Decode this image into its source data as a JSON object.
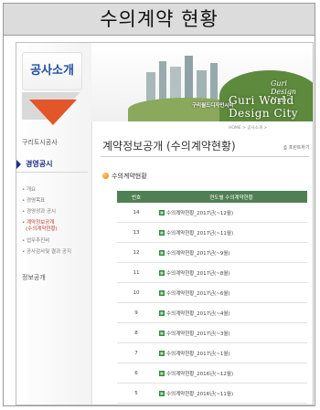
{
  "caption": "수의계약 현황",
  "sidebar": {
    "title": "공사소개",
    "items": [
      {
        "label": "구리도시공사",
        "active": false
      },
      {
        "label": "경영공시",
        "active": true
      }
    ],
    "subitems": [
      {
        "label": "• 개요",
        "highlight": false
      },
      {
        "label": "• 경영목표",
        "highlight": false
      },
      {
        "label": "• 경영성과 공시",
        "highlight": false
      },
      {
        "label": "• 계약정보공개",
        "highlight": true
      },
      {
        "label": "(수의계약현황)",
        "highlight": true
      },
      {
        "label": "• 업무추진비",
        "highlight": false
      },
      {
        "label": "• 공사감사및 결과 공지",
        "highlight": false
      }
    ],
    "bottom": "정보공개"
  },
  "banner": {
    "sub": "구리월드디자인시티",
    "title": "Guri World Design City",
    "script": "Guri Design Hub"
  },
  "breadcrumb": "HOME > 공사소개 >",
  "main": {
    "page_title": "계약정보공개 (수의계약현황)",
    "print_label": "프린트하기",
    "section_title": "수의계약현황",
    "columns": [
      "번호",
      "연도별 수의계약현황"
    ],
    "rows": [
      {
        "no": "14",
        "label": "수의계약현황_2017년(~12월)"
      },
      {
        "no": "13",
        "label": "수의계약현황_2017년(~11월)"
      },
      {
        "no": "12",
        "label": "수의계약현황_2017년(~9월)"
      },
      {
        "no": "11",
        "label": "수의계약현황_2017년(~8월)"
      },
      {
        "no": "10",
        "label": "수의계약현황_2017년(~6월)"
      },
      {
        "no": "9",
        "label": "수의계약현황_2017년(~4월)"
      },
      {
        "no": "8",
        "label": "수의계약현황_2017년(~3월)"
      },
      {
        "no": "7",
        "label": "수의계약현황_2017년(~1월)"
      },
      {
        "no": "6",
        "label": "수의계약현황_2016년(~12월)"
      },
      {
        "no": "5",
        "label": "수의계약현황_2016년(~11월)"
      },
      {
        "no": "4",
        "label": "수의계약현황_2016년(~10월)"
      }
    ]
  },
  "colors": {
    "accent": "#4f7f52",
    "brand": "#1e4fa3",
    "highlight": "#c23b2a"
  }
}
